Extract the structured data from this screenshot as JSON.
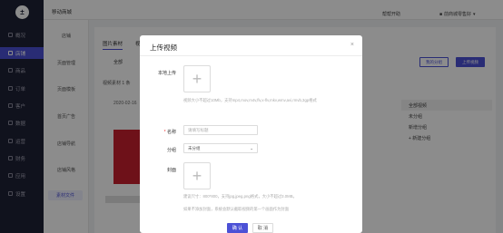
{
  "app": {
    "logo_char": "±",
    "page_title": "移动商城",
    "header_links": [
      "帮帮开助",
      "前商城零售好"
    ]
  },
  "sidebar": {
    "items": [
      {
        "label": "概况",
        "active": false
      },
      {
        "label": "店铺",
        "active": true
      },
      {
        "label": "商品",
        "active": false
      },
      {
        "label": "订单",
        "active": false
      },
      {
        "label": "客户",
        "active": false
      },
      {
        "label": "数据",
        "active": false
      },
      {
        "label": "运营",
        "active": false
      },
      {
        "label": "财务",
        "active": false
      },
      {
        "label": "应用",
        "active": false
      },
      {
        "label": "设置",
        "active": false
      }
    ]
  },
  "subnav": {
    "items": [
      "店铺",
      "页面管理",
      "页面模板",
      "首页广告",
      "店铺导航",
      "店铺风格",
      "素材文件"
    ]
  },
  "main": {
    "tabs": [
      "图片素材",
      "视频素材"
    ],
    "filter_chip": "全部",
    "buttons": [
      "我的分组",
      "上传视频"
    ],
    "breadcrumb": "视频素材 1 条",
    "date_text": "2020-02-16",
    "right_list": [
      "全部视频",
      "未分组",
      "新增分组",
      "+ 新建分组"
    ]
  },
  "modal": {
    "title": "上传视频",
    "close_symbol": "×",
    "local_upload_label": "本地上传",
    "upload_plus": "+",
    "upload_hint": "视频大小不超过10Mb，支持mp4,mov,m4v,flv,x-flv,mkv,wmv,avi,rmvb,3gp格式",
    "name_label": "名称",
    "name_placeholder": "请填写标题",
    "group_label": "分组",
    "group_value": "未分组",
    "cover_label": "封面",
    "cover_plus": "+",
    "cover_hint1": "建议尺寸：800*800，支持jpg,jpeg,png格式，大小不超过3.0MB。",
    "cover_hint2": "如果不添加封面，系统会默认截取视频的第一个画面作为封面",
    "ok_button": "确 认",
    "cancel_button": "取 消"
  },
  "colors": {
    "accent": "#4c51d6",
    "sidebar_bg": "#1e2235"
  }
}
